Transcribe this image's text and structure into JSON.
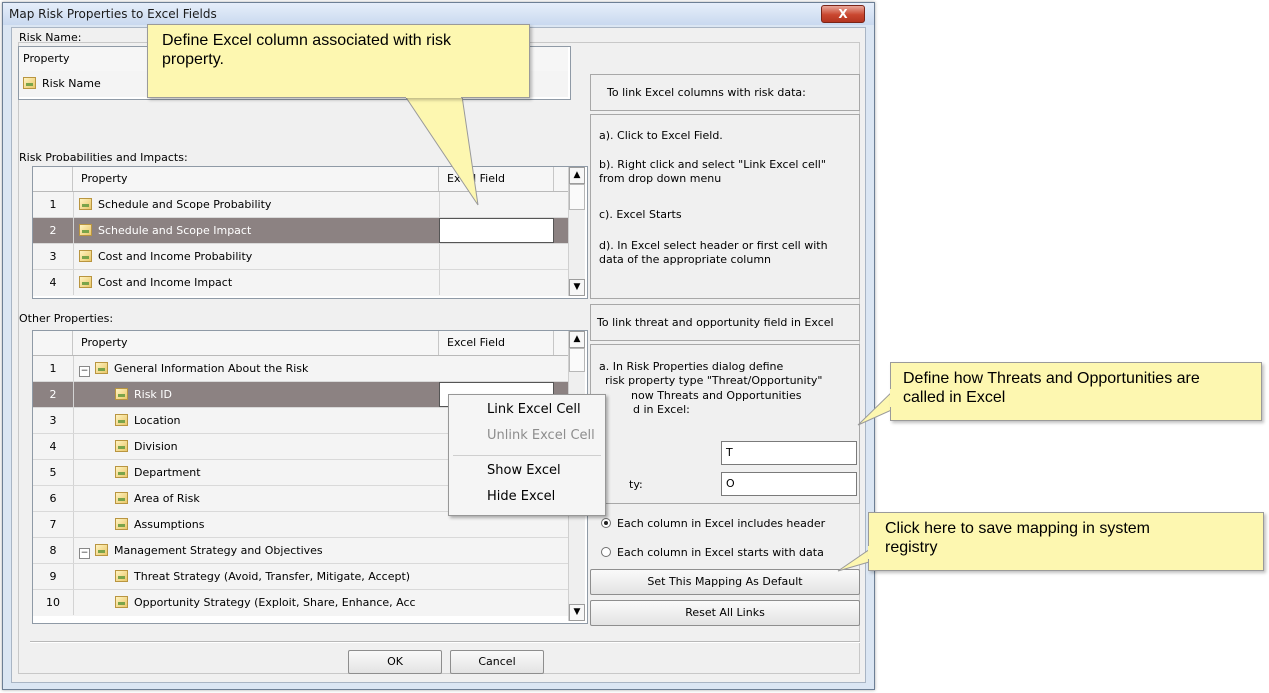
{
  "window": {
    "title": "Map Risk Properties to Excel Fields",
    "close_label": "X"
  },
  "risk_name": {
    "label": "Risk Name:",
    "header_property": "Property",
    "row_label": "Risk Name"
  },
  "prob_impacts": {
    "label": "Risk Probabilities and Impacts:",
    "col_property": "Property",
    "col_field": "Excel Field",
    "rows": [
      {
        "num": "1",
        "label": "Schedule and Scope Probability"
      },
      {
        "num": "2",
        "label": "Schedule and Scope Impact"
      },
      {
        "num": "3",
        "label": "Cost and Income Probability"
      },
      {
        "num": "4",
        "label": "Cost and Income Impact"
      }
    ]
  },
  "other": {
    "label": "Other Properties:",
    "col_property": "Property",
    "col_field": "Excel Field",
    "rows": [
      {
        "num": "1",
        "label": "General Information About the Risk"
      },
      {
        "num": "2",
        "label": "Risk ID"
      },
      {
        "num": "3",
        "label": "Location"
      },
      {
        "num": "4",
        "label": "Division"
      },
      {
        "num": "5",
        "label": "Department"
      },
      {
        "num": "6",
        "label": "Area of Risk"
      },
      {
        "num": "7",
        "label": "Assumptions"
      },
      {
        "num": "8",
        "label": "Management Strategy and Objectives"
      },
      {
        "num": "9",
        "label": "Threat Strategy (Avoid, Transfer, Mitigate, Accept)"
      },
      {
        "num": "10",
        "label": "Opportunity Strategy (Exploit, Share, Enhance, Acc"
      }
    ]
  },
  "instructions": {
    "title": "To link Excel columns with risk data:",
    "step_a": "a). Click to Excel Field.",
    "step_b1": "b). Right click and select \"Link Excel cell\"",
    "step_b2": "from drop down menu",
    "step_c": "c). Excel Starts",
    "step_d1": "d). In Excel select header or first cell with",
    "step_d2": "data of the appropriate column"
  },
  "threat_panel": {
    "title": "To link threat and opportunity field in Excel",
    "line1": "a. In Risk Properties dialog define",
    "line2": "risk property type \"Threat/Opportunity\"",
    "line3": "now Threats and Opportunities",
    "line4": "d in Excel:",
    "threat_value": "T",
    "opportunity_label": "ty:",
    "opportunity_value": "O"
  },
  "options": {
    "radio_header": "Each column in Excel includes header",
    "radio_data": "Each column in Excel starts with data",
    "set_default": "Set This Mapping As Default",
    "reset_links": "Reset All Links"
  },
  "context_menu": {
    "link": "Link Excel Cell",
    "unlink": "Unlink Excel Cell",
    "show": "Show Excel",
    "hide": "Hide Excel"
  },
  "footer": {
    "ok": "OK",
    "cancel": "Cancel"
  },
  "callouts": {
    "excel_column": "Define Excel column associated with risk property.",
    "threats": "Define how Threats and Opportunities are called in Excel",
    "save_mapping": "Click here to save mapping in system registry"
  },
  "colors": {
    "selected_row": "#8c8282",
    "callout_bg": "#fdf7b0"
  }
}
